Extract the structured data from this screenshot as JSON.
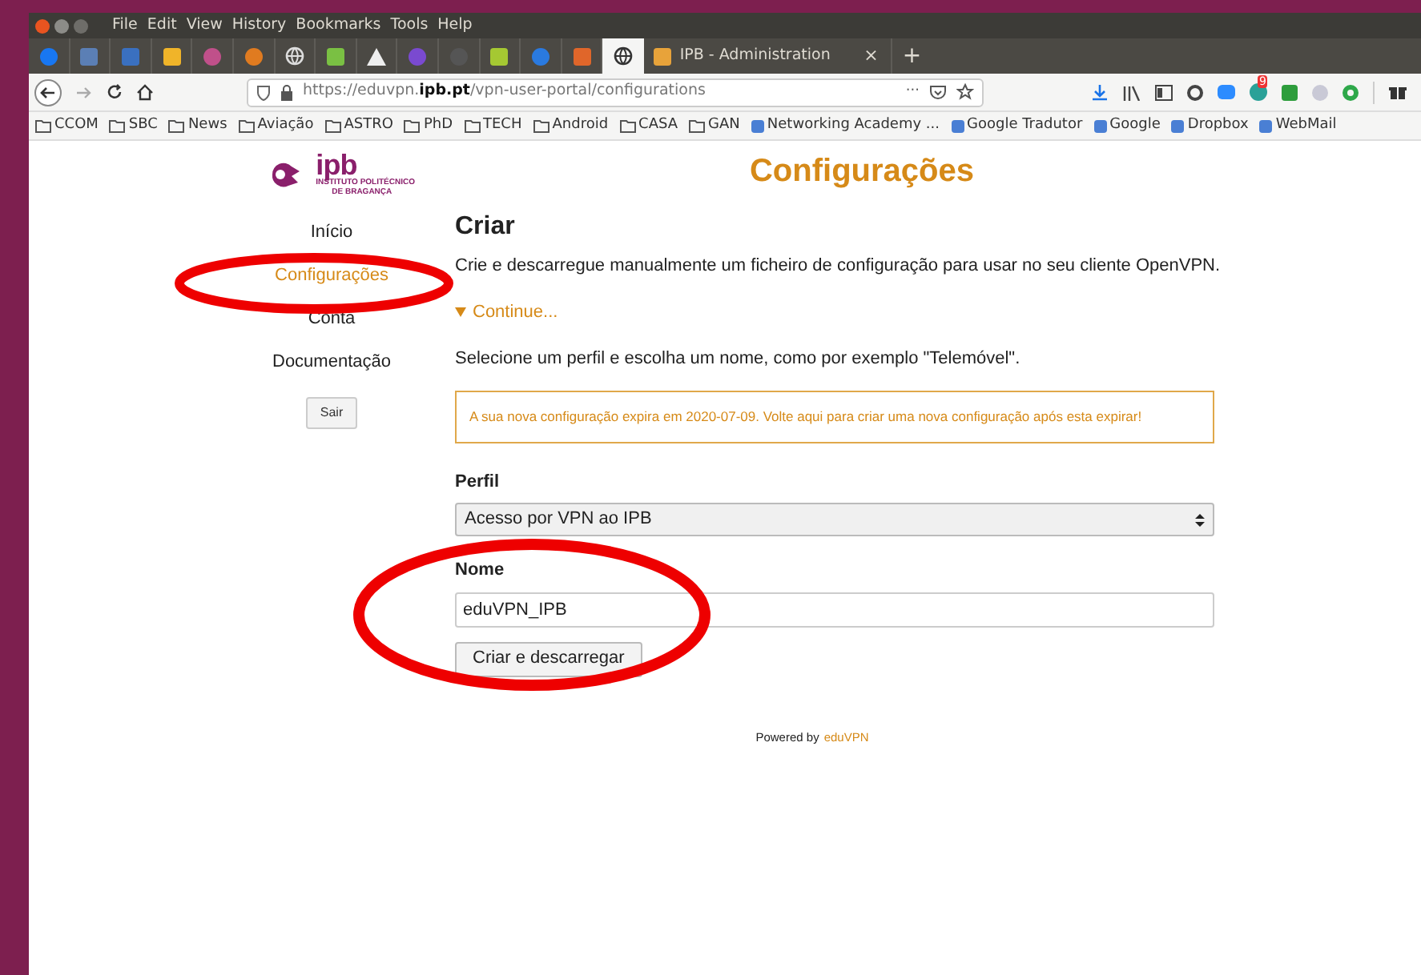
{
  "menu": [
    "File",
    "Edit",
    "View",
    "History",
    "Bookmarks",
    "Tools",
    "Help"
  ],
  "pinned_tabs": [
    {
      "kind": "circle",
      "color": "#1877f2",
      "selected": false
    },
    {
      "kind": "square",
      "color": "#5b7fb5",
      "selected": false
    },
    {
      "kind": "square",
      "color": "#3a70c0",
      "selected": false
    },
    {
      "kind": "square",
      "color": "#f0b429",
      "selected": false
    },
    {
      "kind": "circle",
      "color": "#c0508a",
      "selected": false
    },
    {
      "kind": "circle",
      "color": "#e07b20",
      "selected": false
    },
    {
      "kind": "globe",
      "color": "#dddddd",
      "selected": false
    },
    {
      "kind": "square",
      "color": "#7ac043",
      "selected": false
    },
    {
      "kind": "triangle",
      "color": "#eeeeee",
      "selected": false
    },
    {
      "kind": "circle",
      "color": "#7a4ad0",
      "selected": false
    },
    {
      "kind": "circle",
      "color": "#555555",
      "selected": false
    },
    {
      "kind": "square",
      "color": "#a5c832",
      "selected": false
    },
    {
      "kind": "circle",
      "color": "#2a7ae0",
      "selected": false
    },
    {
      "kind": "square",
      "color": "#e0662a",
      "selected": false
    },
    {
      "kind": "globe",
      "color": "#333333",
      "selected": true
    }
  ],
  "tab": {
    "title": "IPB - Administration",
    "close": "×",
    "selected": false
  },
  "new_tab": "+",
  "url": "https://eduvpn.**ipb.pt**/vpn-user-portal/configurations",
  "url_more": "···",
  "badge": "9",
  "bookmarks": [
    {
      "kind": "folder",
      "label": "CCOM"
    },
    {
      "kind": "folder",
      "label": "SBC"
    },
    {
      "kind": "folder",
      "label": "News"
    },
    {
      "kind": "folder",
      "label": "Aviação"
    },
    {
      "kind": "folder",
      "label": "ASTRO"
    },
    {
      "kind": "folder",
      "label": "PhD"
    },
    {
      "kind": "folder",
      "label": "TECH"
    },
    {
      "kind": "folder",
      "label": "Android"
    },
    {
      "kind": "folder",
      "label": "CASA"
    },
    {
      "kind": "folder",
      "label": "GAN"
    },
    {
      "kind": "site",
      "label": "Networking Academy ..."
    },
    {
      "kind": "site",
      "label": "Google Tradutor"
    },
    {
      "kind": "site",
      "label": "Google"
    },
    {
      "kind": "site",
      "label": "Dropbox"
    },
    {
      "kind": "site",
      "label": "WebMail"
    }
  ],
  "logo": {
    "mark": "ipb",
    "line1": "INSTITUTO POLITÉCNICO",
    "line2": "DE BRAGANÇA"
  },
  "page_title": "Configurações",
  "sidebar": {
    "items": [
      {
        "label": "Início",
        "selected": false
      },
      {
        "label": "Configurações",
        "selected": true
      },
      {
        "label": "Conta",
        "selected": false
      },
      {
        "label": "Documentação",
        "selected": false
      }
    ],
    "logout": "Sair"
  },
  "main": {
    "heading": "Criar",
    "description": "Crie e descarregue manualmente um ficheiro de configuração para usar no seu cliente OpenVPN.",
    "disclosure": {
      "label": "Continue...",
      "expanded": true
    },
    "instructions": "Selecione um perfil e escolha um nome, como por exemplo \"Telemóvel\".",
    "alert": "A sua nova configuração expira em 2020-07-09. Volte aqui para criar uma nova configuração após esta expirar!",
    "profile_label": "Perfil",
    "profile_value": "Acesso por VPN ao IPB",
    "name_label": "Nome",
    "name_value": "eduVPN_IPB",
    "submit": "Criar e descarregar"
  },
  "footer": {
    "text": "Powered by",
    "link": "eduVPN"
  }
}
